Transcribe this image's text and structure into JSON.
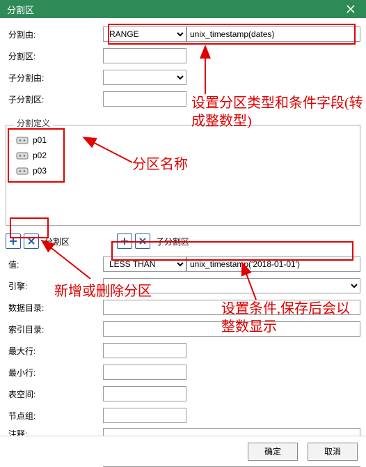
{
  "window": {
    "title": "分割区"
  },
  "labels": {
    "partition_by": "分割由:",
    "partition_zone": "分割区:",
    "sub_partition_by": "子分割由:",
    "sub_partition_zone": "子分割区:",
    "definition_legend": "分割定义",
    "toolbar_zone_label": "分割区",
    "toolbar_subzone_label": "子分割区",
    "value": "值:",
    "engine": "引擎:",
    "data_dir": "数据目录:",
    "index_dir": "索引目录:",
    "max_row": "最大行:",
    "min_row": "最小行:",
    "tablespace": "表空间:",
    "nodegroup": "节点组:",
    "notes": "注释:"
  },
  "partition_by": {
    "type": "RANGE",
    "options": [
      "RANGE"
    ],
    "expression": "unix_timestamp(dates)"
  },
  "partitions": [
    {
      "name": "p01"
    },
    {
      "name": "p02"
    },
    {
      "name": "p03"
    }
  ],
  "value_row": {
    "operator": "LESS THAN",
    "options": [
      "LESS THAN"
    ],
    "expression": "unix_timestamp('2018-01-01')"
  },
  "buttons": {
    "ok": "确定",
    "cancel": "取消"
  },
  "annotations": {
    "type_field": "设置分区类型和条件字段(转成整数型)",
    "part_name": "分区名称",
    "add_delete": "新增或删除分区",
    "condition": "设置条件,保存后会以整数显示"
  },
  "colors": {
    "titlebar": "#2e8b57",
    "highlight": "#e00000"
  }
}
